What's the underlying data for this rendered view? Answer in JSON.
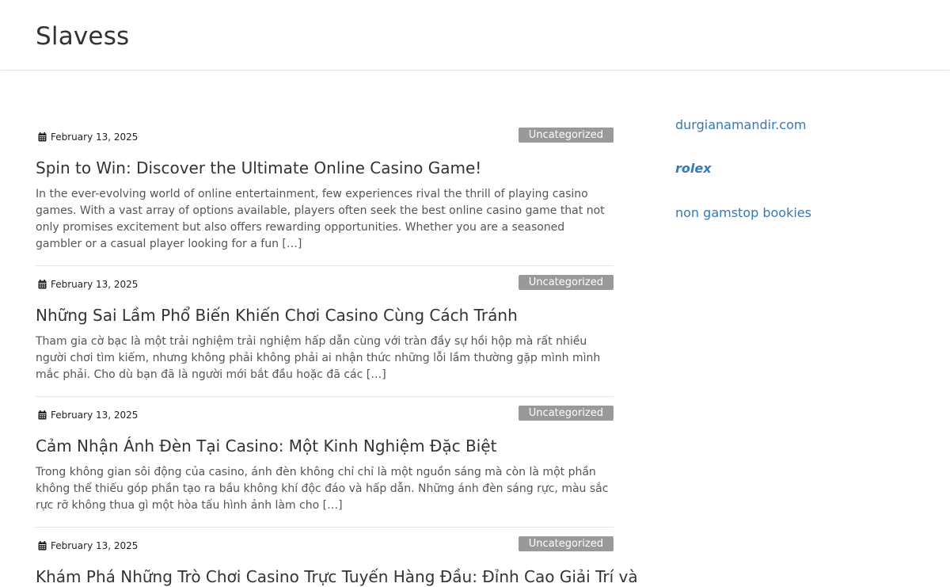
{
  "site": {
    "title": "Slavess"
  },
  "posts": [
    {
      "date": "February 13, 2025",
      "category": "Uncategorized",
      "title": "Spin to Win: Discover the Ultimate Online Casino Game!",
      "excerpt": "In the ever-evolving world of online entertainment, few experiences rival the thrill of playing casino games. With a vast array of options available, players often seek the best online casino game that not only promises excitement but also offers rewarding opportunities. Whether you are a seasoned gambler or a casual player looking for a fun […]"
    },
    {
      "date": "February 13, 2025",
      "category": "Uncategorized",
      "title": "Những Sai Lầm Phổ Biến Khiến Chơi Casino Cùng Cách Tránh",
      "excerpt": "Tham gia cờ bạc là một trải nghiệm trải nghiệm hấp dẫn cùng với tràn đầy sự hồi hộp mà rất nhiều người chơi tìm kiếm, nhưng không phải không phải ai nhận thức những lỗi lầm thường gặp mình mình mắc phải. Cho dù bạn đã là người mới bắt đầu hoặc đã các […]"
    },
    {
      "date": "February 13, 2025",
      "category": "Uncategorized",
      "title": "Cảm Nhận Ánh Đèn Tại Casino: Một Kinh Nghiệm Đặc Biệt",
      "excerpt": "Trong không gian sôi động của casino, ánh đèn không chỉ chỉ là một nguồn sáng mà còn là một phần không thể thiếu góp phần tạo ra bầu không khí độc đáo và hấp dẫn. Những ánh đèn sáng rực, màu sắc rực rỡ không thua gì một hòa tấu hình ảnh làm cho […]"
    },
    {
      "date": "February 13, 2025",
      "category": "Uncategorized",
      "title": "Khám Phá Những Trò Chơi Casino Trực Tuyến Hàng Đầu: Đỉnh Cao Giải Trí và",
      "excerpt": ""
    }
  ],
  "sidebar": {
    "links": [
      {
        "label": "durgianamandir.com"
      },
      {
        "label": "rolex"
      },
      {
        "label": "non gamstop bookies"
      }
    ]
  },
  "colors": {
    "link": "#337ab7",
    "badge": "#999999",
    "title": "#333333"
  },
  "icons": {
    "date": "calendar-icon"
  }
}
